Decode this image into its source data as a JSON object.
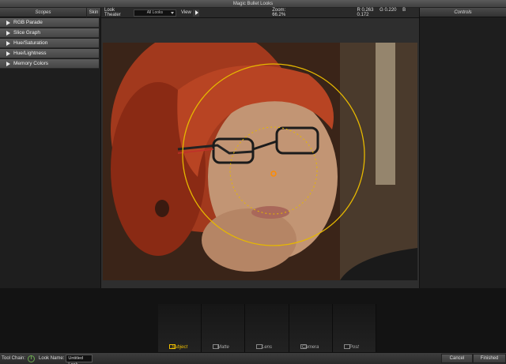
{
  "window": {
    "title": "Magic Bullet Looks"
  },
  "scopes": {
    "title": "Scopes",
    "skin_label": "Skin",
    "items": [
      {
        "label": "RGB Parade"
      },
      {
        "label": "Slice Graph"
      },
      {
        "label": "Hue/Saturation"
      },
      {
        "label": "Hue/Lightness"
      },
      {
        "label": "Memory Colors"
      }
    ]
  },
  "look_theater": {
    "label": "Look Theater",
    "looks_value": "All Looks",
    "view_label": "View",
    "zoom_label": "Zoom:",
    "zoom_value": "66.2%",
    "r": "R 0.263",
    "g": "G 0.220",
    "b": "B 0.172"
  },
  "controls": {
    "title": "Controls"
  },
  "tools": [
    {
      "label": "Subject",
      "icon": "subject-icon",
      "active": true
    },
    {
      "label": "Matte",
      "icon": "matte-icon",
      "active": false
    },
    {
      "label": "Lens",
      "icon": "lens-icon",
      "active": false
    },
    {
      "label": "Camera",
      "icon": "camera-icon",
      "active": false
    },
    {
      "label": "Post",
      "icon": "post-icon",
      "active": false
    }
  ],
  "bottom": {
    "tool_chain_label": "Tool Chain:",
    "look_name_label": "Look Name:",
    "look_name_value": "Untitled Look",
    "cancel_label": "Cancel",
    "finished_label": "Finished"
  },
  "colors": {
    "accent": "#f0c000",
    "power": "#6aa84f",
    "overlay": "#e6b800"
  }
}
